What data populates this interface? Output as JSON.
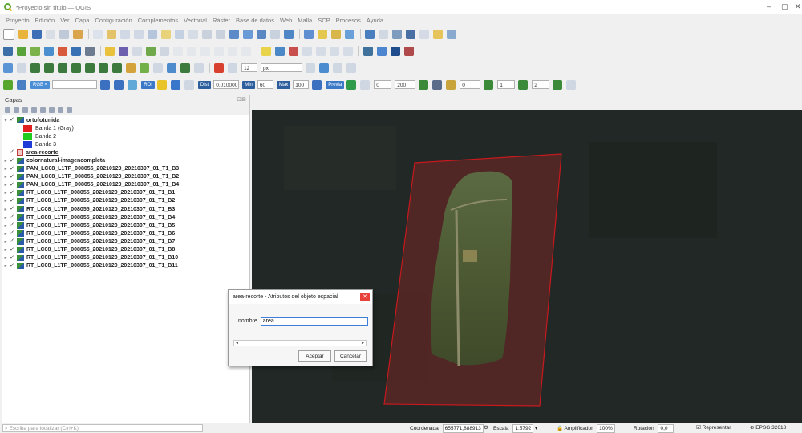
{
  "window": {
    "title": "*Proyecto sin título — QGIS",
    "controls": [
      "–",
      "▢",
      "✕"
    ]
  },
  "menu": [
    "Proyecto",
    "Edición",
    "Ver",
    "Capa",
    "Configuración",
    "Complementos",
    "Vectorial",
    "Ráster",
    "Base de datos",
    "Web",
    "Malla",
    "SCP",
    "Procesos",
    "Ayuda"
  ],
  "toolbar": {
    "rgb_label": "RGB =",
    "roi_label": "ROI",
    "dist_label": "Dist",
    "dist_value": "0.010000",
    "min_label": "Min",
    "min_value": "60",
    "max_label": "Max",
    "max_value": "100",
    "preview_label": "Previa",
    "t_value": "0",
    "s_value": "200",
    "b_value": "0",
    "band1_value": "1",
    "band2_value": "2",
    "spin12": "12",
    "unit_px": "px"
  },
  "layers_panel": {
    "title": "Capas",
    "items": [
      {
        "label": "ortofotunida",
        "bold": true,
        "kind": "raster",
        "expanded": true
      },
      {
        "label": "Banda 1 (Gray)",
        "kind": "band",
        "color": "#e02020"
      },
      {
        "label": "Banda 2",
        "kind": "band",
        "color": "#1fcc1f"
      },
      {
        "label": "Banda 3",
        "kind": "band",
        "color": "#1f3ad6"
      },
      {
        "label": "area-recorte",
        "bold": true,
        "kind": "polygon",
        "underline": true
      },
      {
        "label": "colornatural-imagencompleta",
        "bold": true,
        "kind": "raster"
      },
      {
        "label": "PAN_LC08_L1TP_008055_20210120_20210307_01_T1_B3",
        "bold": true,
        "kind": "raster"
      },
      {
        "label": "PAN_LC08_L1TP_008055_20210120_20210307_01_T1_B2",
        "bold": true,
        "kind": "raster"
      },
      {
        "label": "PAN_LC08_L1TP_008055_20210120_20210307_01_T1_B4",
        "bold": true,
        "kind": "raster"
      },
      {
        "label": "RT_LC08_L1TP_008055_20210120_20210307_01_T1_B1",
        "bold": true,
        "kind": "raster"
      },
      {
        "label": "RT_LC08_L1TP_008055_20210120_20210307_01_T1_B2",
        "bold": true,
        "kind": "raster"
      },
      {
        "label": "RT_LC08_L1TP_008055_20210120_20210307_01_T1_B3",
        "bold": true,
        "kind": "raster"
      },
      {
        "label": "RT_LC08_L1TP_008055_20210120_20210307_01_T1_B4",
        "bold": true,
        "kind": "raster"
      },
      {
        "label": "RT_LC08_L1TP_008055_20210120_20210307_01_T1_B5",
        "bold": true,
        "kind": "raster"
      },
      {
        "label": "RT_LC08_L1TP_008055_20210120_20210307_01_T1_B6",
        "bold": true,
        "kind": "raster"
      },
      {
        "label": "RT_LC08_L1TP_008055_20210120_20210307_01_T1_B7",
        "bold": true,
        "kind": "raster"
      },
      {
        "label": "RT_LC08_L1TP_008055_20210120_20210307_01_T1_B8",
        "bold": true,
        "kind": "raster"
      },
      {
        "label": "RT_LC08_L1TP_008055_20210120_20210307_01_T1_B10",
        "bold": true,
        "kind": "raster"
      },
      {
        "label": "RT_LC08_L1TP_008055_20210120_20210307_01_T1_B11",
        "bold": true,
        "kind": "raster"
      }
    ]
  },
  "dialog": {
    "title": "area-recorte - Atributos del objeto espacial",
    "field_label": "nombre",
    "field_value": "area",
    "ok_label": "Aceptar",
    "cancel_label": "Cancelar"
  },
  "statusbar": {
    "search_placeholder": "Escriba para localizar (Ctrl+K)",
    "coord_label": "Coordenada",
    "coord_value": "655771,888913",
    "scale_label": "Escala",
    "scale_value": "1:5792",
    "magnifier_label": "Amplificador",
    "magnifier_value": "100%",
    "rotation_label": "Rotación",
    "rotation_value": "0,0 °",
    "render_label": "Representar",
    "crs_label": "EPSG:32618"
  },
  "colors": {
    "qgis_green": "#58a62d",
    "polygon_stroke": "#c8191e",
    "polygon_fill": "rgba(200,40,40,0.28)",
    "dialog_close": "#e8413a"
  }
}
